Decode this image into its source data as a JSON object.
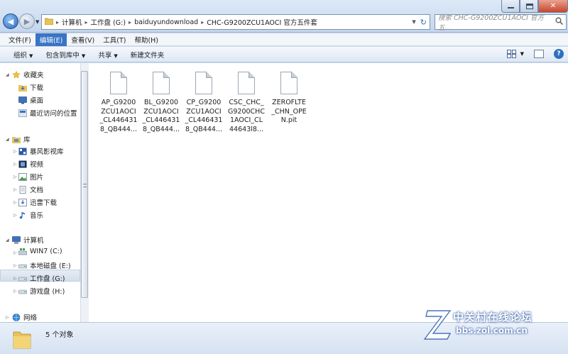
{
  "address": {
    "segments": [
      "计算机",
      "工作盘 (G:)",
      "baiduyundownload",
      "CHC-G9200ZCU1AOCI 官方五件套"
    ]
  },
  "search": {
    "placeholder": "搜索 CHC-G9200ZCU1AOCI 官方五..."
  },
  "menu": [
    "文件(F)",
    "编辑(E)",
    "查看(V)",
    "工具(T)",
    "帮助(H)"
  ],
  "toolbar": {
    "organize": "组织",
    "include_library": "包含到库中",
    "share": "共享",
    "new_folder": "新建文件夹"
  },
  "nav": {
    "favorites": {
      "title": "收藏夹",
      "items": [
        "下载",
        "桌面",
        "最近访问的位置"
      ]
    },
    "libraries": {
      "title": "库",
      "items": [
        "暴风影视库",
        "视频",
        "图片",
        "文档",
        "迅雷下载",
        "音乐"
      ]
    },
    "computer": {
      "title": "计算机",
      "items": [
        "WIN7 (C:)",
        "本地磁盘 (E:)",
        "工作盘 (G:)",
        "游戏盘 (H:)"
      ]
    },
    "network": {
      "title": "网络"
    }
  },
  "files": [
    {
      "lines": [
        "AP_G9200",
        "ZCU1AOCI",
        "_CL446431",
        "8_QB444..."
      ]
    },
    {
      "lines": [
        "BL_G9200",
        "ZCU1AOCI",
        "_CL446431",
        "8_QB444..."
      ]
    },
    {
      "lines": [
        "CP_G9200",
        "ZCU1AOCI",
        "_CL446431",
        "8_QB444..."
      ]
    },
    {
      "lines": [
        "CSC_CHC_",
        "G9200CHC",
        "1AOCI_CL",
        "44643l8..."
      ]
    },
    {
      "lines": [
        "ZEROFLTE",
        "_CHN_OPE",
        "N.pit"
      ]
    }
  ],
  "status": {
    "count": "5 个对象"
  },
  "watermark": {
    "brand": "中关村在线论坛",
    "url": "bbs.zol.com.cn"
  },
  "colors": {
    "accent": "#3a74c4",
    "chrome": "#c9d9ee",
    "close": "#c8452c"
  }
}
